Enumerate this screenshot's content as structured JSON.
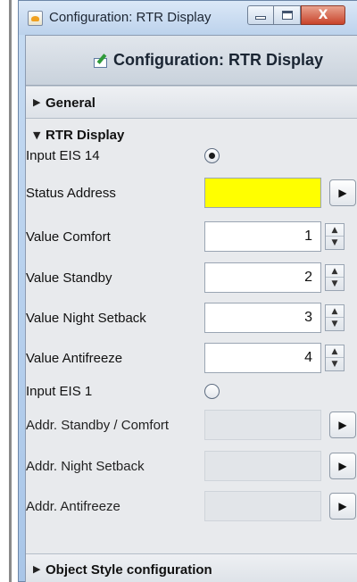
{
  "window": {
    "title": "Configuration: RTR Display",
    "minimize_icon": "minimize-icon",
    "maximize_icon": "maximize-icon",
    "close_glyph": "X"
  },
  "dialog": {
    "title": "Configuration: RTR Display",
    "icon": "edit-icon"
  },
  "sections": {
    "general": {
      "arrow": "▶",
      "label": "General"
    },
    "rtr": {
      "arrow": "▼",
      "label": "RTR Display"
    },
    "object_style": {
      "arrow": "▶",
      "label": "Object Style configuration"
    }
  },
  "rows": {
    "input_eis14": {
      "label": "Input EIS 14",
      "selected": true
    },
    "status_address": {
      "label": "Status Address",
      "value": "",
      "button": "▶",
      "highlight_color": "#ffff00"
    },
    "value_comfort": {
      "label": "Value Comfort",
      "value": "1"
    },
    "value_standby": {
      "label": "Value Standby",
      "value": "2"
    },
    "value_night": {
      "label": "Value Night Setback",
      "value": "3"
    },
    "value_antifreeze": {
      "label": "Value Antifreeze",
      "value": "4"
    },
    "input_eis1": {
      "label": "Input EIS 1",
      "selected": false
    },
    "addr_standby": {
      "label": "Addr. Standby / Comfort",
      "value": "",
      "button": "▶"
    },
    "addr_night": {
      "label": "Addr. Night Setback",
      "value": "",
      "button": "▶"
    },
    "addr_antifreeze": {
      "label": "Addr. Antifreeze",
      "value": "",
      "button": "▶"
    }
  },
  "spinner": {
    "up": "▲",
    "down": "▼"
  }
}
